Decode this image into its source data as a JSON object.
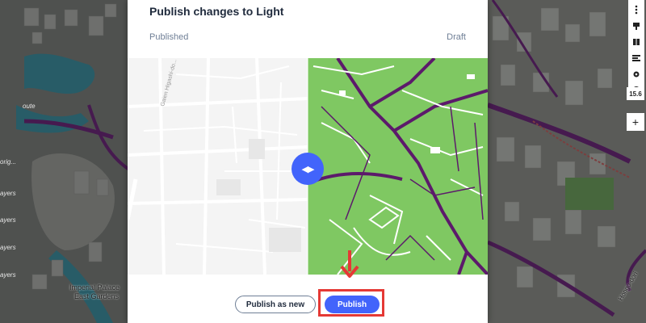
{
  "modal": {
    "title": "Publish changes to Light",
    "published_label": "Published",
    "draft_label": "Draft"
  },
  "compare": {
    "street_label": "Gaien Higashi-do...",
    "handle_icon": "split-arrows-icon"
  },
  "buttons": {
    "publish_as_new": "Publish as new",
    "publish": "Publish"
  },
  "background": {
    "place_label_1": "Imperial Palace",
    "place_label_2": "East Gardens",
    "road_label": "Hongo-dori",
    "side_labels": [
      "orig...",
      "ayers",
      "ayers",
      "ayers",
      "ayers",
      "oute"
    ]
  },
  "toolbar": {
    "zoom_level": "15.6",
    "icons": [
      "settings-dots-icon",
      "paint-icon",
      "book-icon",
      "layers-icon",
      "gear-icon",
      "help-icon"
    ],
    "plus_label": "+"
  },
  "colors": {
    "accent": "#4264fb",
    "highlight": "#e53935",
    "draft_green": "#7fc862",
    "draft_road": "#5c1a6b"
  }
}
